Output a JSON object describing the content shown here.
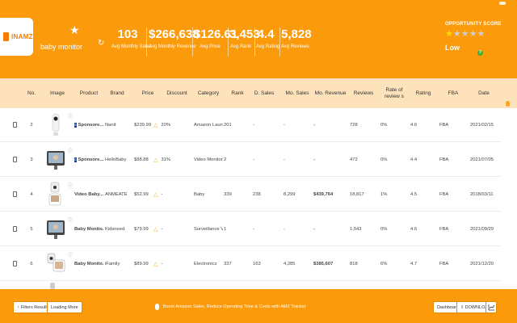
{
  "app": {
    "logo_text": "INAMZ",
    "keyword": "baby monitor",
    "star_icon": "star-icon",
    "refresh_icon": "refresh-icon"
  },
  "metrics": [
    {
      "value": "103",
      "label": "Avg Monthly Sales"
    },
    {
      "value": "$266,638",
      "label": "Avg Monthly Revenue"
    },
    {
      "value": "$126.61",
      "label": "Avg Price"
    },
    {
      "value": "3,453",
      "label": "Avg Rank"
    },
    {
      "value": "4.4",
      "label": "Avg Rating"
    },
    {
      "value": "5,828",
      "label": "Avg Reviews"
    }
  ],
  "opportunity": {
    "title": "OPPORTUNITY SCORE",
    "stars_filled": 1,
    "stars_total": 5,
    "level": "Low",
    "info_icon": "info-icon"
  },
  "columns": {
    "no": "No.",
    "image": "Image",
    "product": "Product",
    "brand": "Brand",
    "price": "Price",
    "discount": "Discount",
    "category": "Category",
    "rank": "Rank",
    "d_sales": "D. Sales",
    "mo_sales": "Mo. Sales",
    "mo_revenue": "Mo. Revenue",
    "reviews": "Reviews",
    "rate_of_reviews": "Rate of review s",
    "rating": "Rating",
    "fba": "FBA",
    "date": "Date"
  },
  "rows": [
    {
      "no": "2",
      "sponsored": true,
      "product": "Sponsore...",
      "brand": "Nanit",
      "price": "$239.99",
      "discount": "20%",
      "category": "Amazon Launc...",
      "rank": "201",
      "d_sales": "-",
      "mo_sales": "-",
      "mo_revenue": "-",
      "reviews": "728",
      "rate": "0%",
      "rating": "4.6",
      "fba": "FBA",
      "date": "2021/02/15"
    },
    {
      "no": "3",
      "sponsored": true,
      "product": "Sponsore...",
      "brand": "HelloBaby",
      "price": "$88.88",
      "discount": "31%",
      "category": "Video Monitors",
      "rank": "2",
      "d_sales": "-",
      "mo_sales": "-",
      "mo_revenue": "-",
      "reviews": "472",
      "rate": "0%",
      "rating": "4.4",
      "fba": "FBA",
      "date": "2021/07/05"
    },
    {
      "no": "4",
      "sponsored": false,
      "product": "Video Baby...",
      "brand": "ANMEATE",
      "price": "$52.99",
      "discount": "-",
      "category": "Baby",
      "rank": "339",
      "d_sales": "238",
      "mo_sales": "8,299",
      "mo_revenue": "$439,764",
      "reviews": "18,817",
      "rate": "1%",
      "rating": "4.5",
      "fba": "FBA",
      "date": "2018/03/11"
    },
    {
      "no": "5",
      "sponsored": false,
      "product": "Baby Monito...",
      "brand": "Kidsneed",
      "price": "$79.99",
      "discount": "-",
      "category": "Surveillance V...",
      "rank": "1",
      "d_sales": "-",
      "mo_sales": "-",
      "mo_revenue": "-",
      "reviews": "1,543",
      "rate": "0%",
      "rating": "4.6",
      "fba": "FBA",
      "date": "2021/09/29"
    },
    {
      "no": "6",
      "sponsored": false,
      "product": "Baby Monito...",
      "brand": "iFamily",
      "price": "$89.99",
      "discount": "-",
      "category": "Electronics",
      "rank": "337",
      "d_sales": "163",
      "mo_sales": "4,285",
      "mo_revenue": "$385,607",
      "reviews": "818",
      "rate": "6%",
      "rating": "4.7",
      "fba": "FBA",
      "date": "2021/12/20"
    }
  ],
  "footer": {
    "filters_label": "Filters Results",
    "loading_label": "Loading More",
    "promo_text": "Boost Amazon Sales, Reduce Operating Time & Costs with AMZ Tracker",
    "dashboard_label": "Dashboard",
    "download_label": "DOWNLOAD",
    "chart_icon": "chart-icon"
  },
  "colors": {
    "brand_orange": "#fb9a0b",
    "header_row": "#fde2bb",
    "star_yellow": "#ffe000",
    "info_green": "#43b03c"
  }
}
